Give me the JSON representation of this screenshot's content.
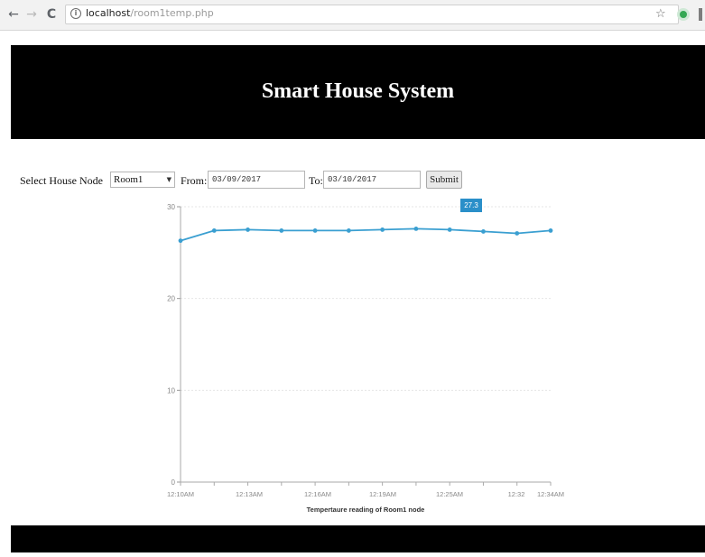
{
  "browser": {
    "back_glyph": "←",
    "forward_glyph": "→",
    "reload_glyph": "C",
    "info_glyph": "i",
    "url_host": "localhost",
    "url_path": "/room1temp.php",
    "star_glyph": "☆",
    "icons": {
      "back": "back-arrow-icon",
      "forward": "forward-arrow-icon",
      "reload": "reload-icon",
      "info": "info-icon",
      "bookmark": "star-icon",
      "extension": "extension-icon"
    },
    "extension_color": "#34a853"
  },
  "header": {
    "title": "Smart House System",
    "background": "#000000"
  },
  "form": {
    "node_label": "Select House Node",
    "node_selected": "Room1",
    "from_label": "From:",
    "from_value": "03/09/2017",
    "to_label": "To:",
    "to_value": "03/10/2017",
    "submit_label": "Submit"
  },
  "tooltip": {
    "text": "27.3",
    "color": "#2a8fc9"
  },
  "chart_data": {
    "type": "line",
    "xlabel": "Tempertaure reading of Room1 node",
    "ylabel": "",
    "ylim": [
      0,
      30
    ],
    "yticks": [
      0,
      10,
      20,
      30
    ],
    "x_tick_labels": [
      "12:10AM",
      "12:13AM",
      "12:16AM",
      "12:19AM",
      "12:25AM",
      "12:32",
      "12:34AM"
    ],
    "grid": true,
    "line_color": "#3a9fd1",
    "series": [
      {
        "values": [
          26.3,
          27.4,
          27.5,
          27.4,
          27.4,
          27.4,
          27.5,
          27.6,
          27.5,
          27.3,
          27.1,
          27.4
        ]
      }
    ]
  }
}
